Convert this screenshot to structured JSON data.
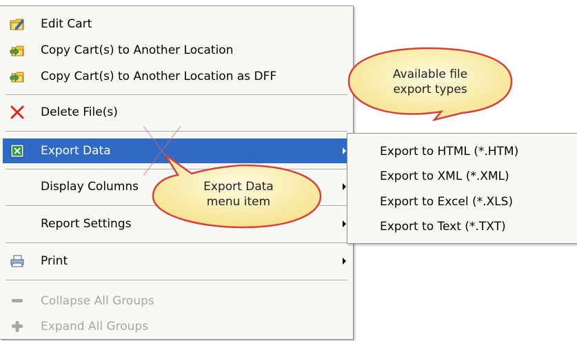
{
  "menu": {
    "items": [
      {
        "label": "Edit Cart",
        "icon": "edit-cart-icon"
      },
      {
        "label": "Copy Cart(s) to Another Location",
        "icon": "copy-cart-icon"
      },
      {
        "label": "Copy Cart(s) to Another Location as DFF",
        "icon": "copy-cart-dff-icon"
      },
      {
        "label": "Delete File(s)",
        "icon": "delete-x-icon"
      },
      {
        "label": "Export Data",
        "icon": "export-data-icon"
      },
      {
        "label": "Display Columns"
      },
      {
        "label": "Report Settings"
      },
      {
        "label": "Print",
        "icon": "printer-icon"
      },
      {
        "label": "Collapse All Groups",
        "icon": "minus-icon"
      },
      {
        "label": "Expand All Groups",
        "icon": "plus-icon"
      }
    ]
  },
  "submenu": {
    "items": [
      {
        "label": "Export to HTML (*.HTM)"
      },
      {
        "label": "Export to XML (*.XML)"
      },
      {
        "label": "Export to Excel (*.XLS)"
      },
      {
        "label": "Export to Text (*.TXT)"
      }
    ]
  },
  "callouts": {
    "file_types": {
      "line1": "Available file",
      "line2": "export types"
    },
    "menu_item": {
      "line1": "Export Data",
      "line2": "menu item"
    }
  },
  "colors": {
    "selection": "#316ac5",
    "callout_fill": "#fcf3b5",
    "callout_border": "#d6403a",
    "menu_bg": "#f9f8f4",
    "disabled_text": "#a7a6aa"
  }
}
